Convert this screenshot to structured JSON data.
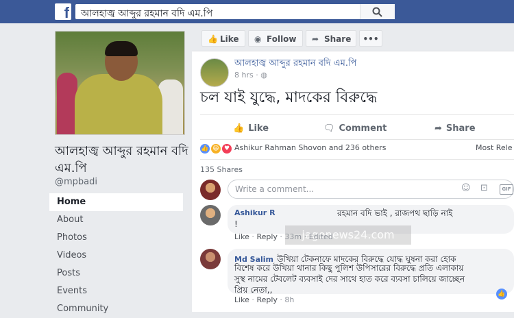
{
  "topbar": {
    "logo": "f",
    "search_value": "আলহাজ্ব আব্দুর রহমান বদি এম.পি",
    "search_icon": "magnifier-icon"
  },
  "page": {
    "name": "আলহাজ্ব আব্দুর রহমান বদি এম.পি",
    "handle": "@mpbadi"
  },
  "nav": [
    {
      "label": "Home",
      "active": true
    },
    {
      "label": "About"
    },
    {
      "label": "Photos"
    },
    {
      "label": "Videos"
    },
    {
      "label": "Posts"
    },
    {
      "label": "Events"
    },
    {
      "label": "Community"
    }
  ],
  "actions": {
    "like": "Like",
    "follow": "Follow",
    "share": "Share",
    "more": "•••"
  },
  "post": {
    "author": "আলহাজ্ব আব্দুর রহমান বদি এম.পি",
    "time": "8 hrs · ",
    "text": "চল যাই যুদ্ধে, মাদকের বিরুদ্ধে",
    "like_label": "Like",
    "comment_label": "Comment",
    "share_label": "Share",
    "reactors": "Ashikur Rahman Shovon and 236 others",
    "most_relevant": "Most Rele",
    "shares": "135 Shares"
  },
  "comment_box": {
    "placeholder": "Write a comment...",
    "gif": "GIF"
  },
  "comments": [
    {
      "name": "Ashikur R",
      "line1": "রহমান বদি ভাই , রাজপথ ছাড়ি নাই",
      "line2": "!",
      "watermark": "jagonews24.com",
      "meta_like": "Like",
      "meta_reply": "Reply",
      "meta_time": "33m",
      "meta_edited": "Edited"
    },
    {
      "name": "Md Salim",
      "line1": "উখিয়া টেকনাফে মাদকের বিরুদ্ধে যোদ্ধ ঘুষনা করা হোক",
      "line2": "বিশেষ করে উখিয়া থানার কিছু পুলিশ উপিসারের বিরুদ্ধে প্রতি এলাকায়",
      "line3": "সুস্থ নামের টেবলেট ব্যবসাই দের সাথে হাত করে ব্যবসা চালিয়ে জাচ্ছেন",
      "line4": "প্রিয় নেতা,,",
      "meta_like": "Like",
      "meta_reply": "Reply",
      "meta_time": "8h"
    }
  ],
  "colors": {
    "fb_blue": "#3b5998",
    "link": "#365899",
    "background": "#e9ebee"
  }
}
